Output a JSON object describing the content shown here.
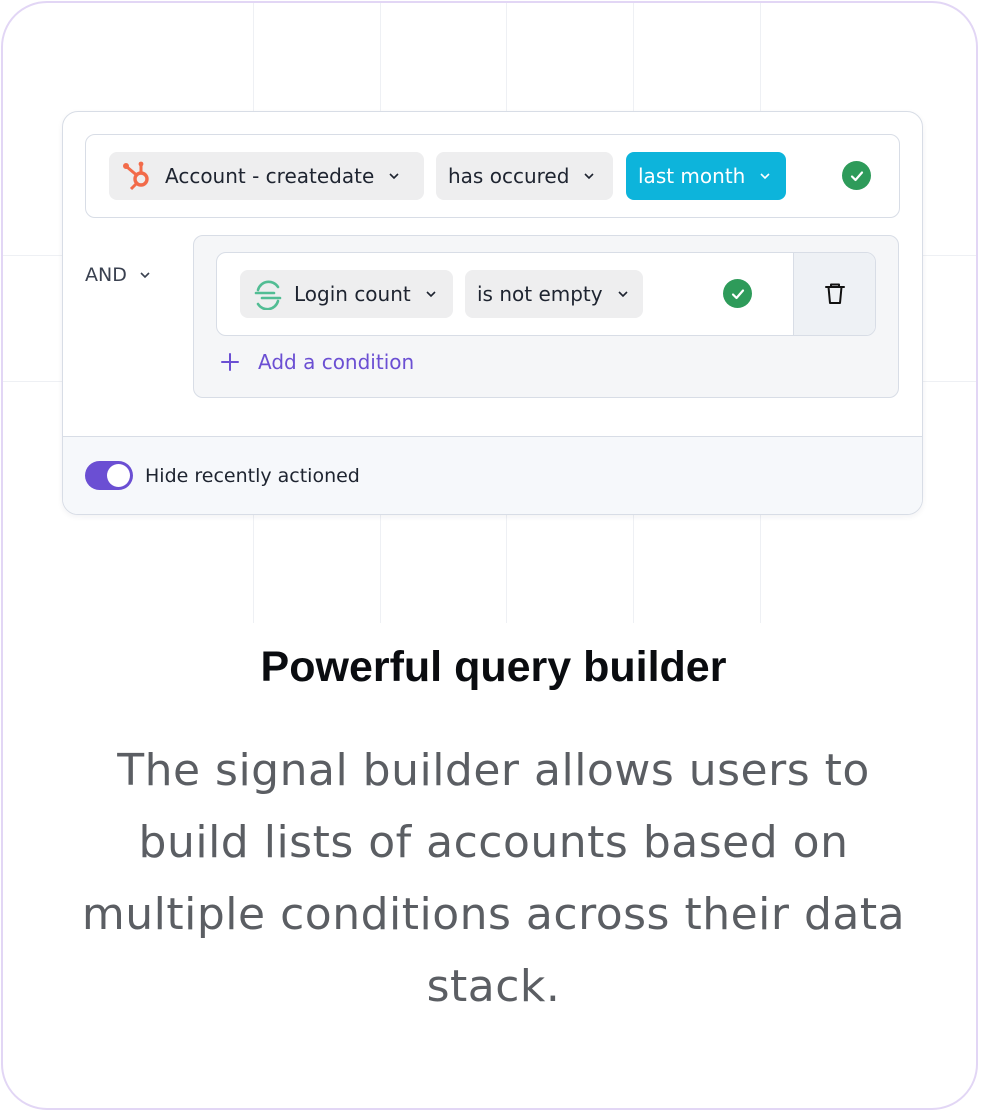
{
  "builder": {
    "row1": {
      "field_label": "Account - createdate",
      "field_icon": "hubspot-icon",
      "operator_label": "has occured",
      "value_label": "last month",
      "status_icon": "check-circle-icon"
    },
    "connector_label": "AND",
    "group": {
      "row": {
        "field_label": "Login count",
        "field_icon": "segment-icon",
        "operator_label": "is not empty",
        "status_icon": "check-circle-icon",
        "delete_icon": "trash-icon"
      },
      "add_condition_label": "Add a condition"
    },
    "footer": {
      "toggle_on": true,
      "toggle_label": "Hide recently actioned"
    }
  },
  "colors": {
    "accent_purple": "#6b4fd3",
    "cyan": "#0db4db",
    "success_green": "#2e9b5a",
    "hubspot_orange": "#f26b4a",
    "segment_green": "#52bd94"
  },
  "content": {
    "title": "Powerful query builder",
    "description": "The signal builder allows users to build lists of accounts based on multiple conditions across their data stack."
  }
}
